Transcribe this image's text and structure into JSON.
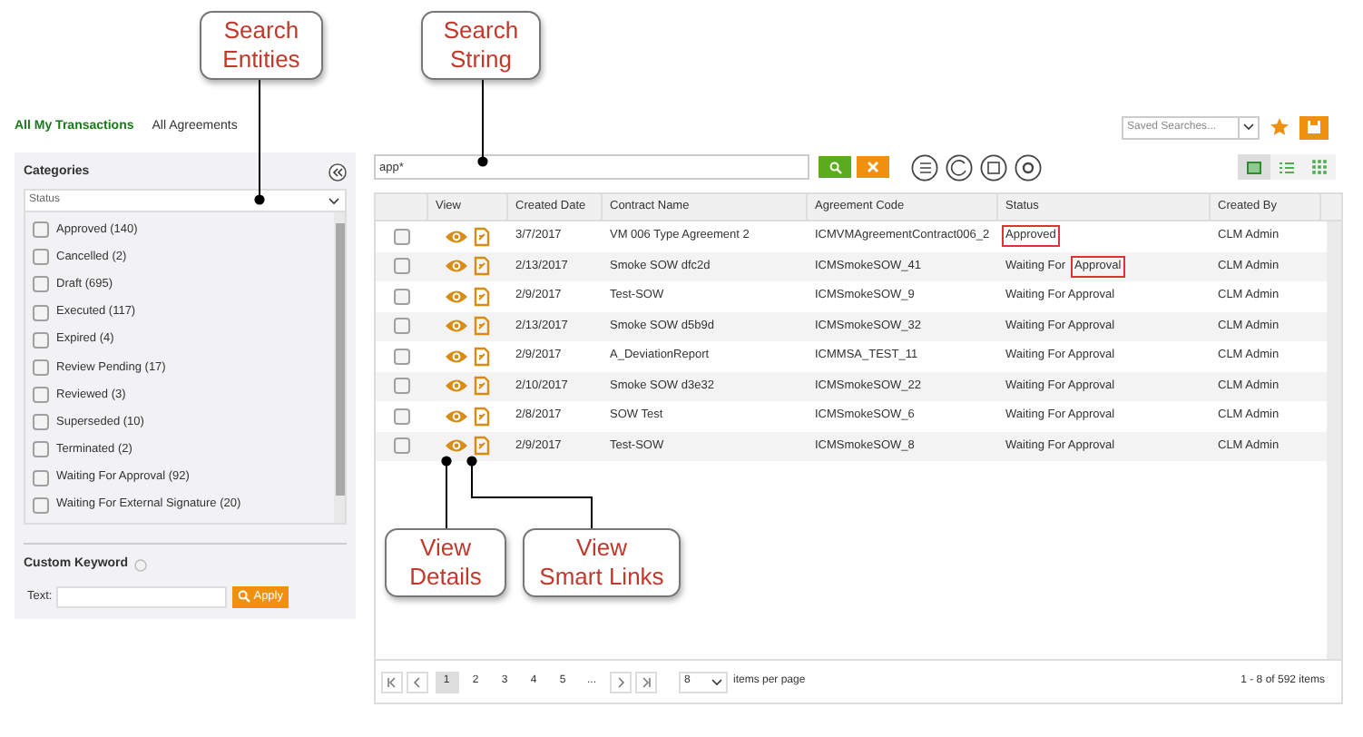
{
  "tabs": [
    {
      "label": "All My Transactions",
      "selected": true
    },
    {
      "label": "All Agreements",
      "selected": false
    }
  ],
  "sidebar": {
    "title": "Categories",
    "category_select": "Status",
    "items": [
      {
        "label": "Approved (140)",
        "checked": false
      },
      {
        "label": "Cancelled (2)",
        "checked": false
      },
      {
        "label": "Draft (695)",
        "checked": false
      },
      {
        "label": "Executed (117)",
        "checked": false
      },
      {
        "label": "Expired (4)",
        "checked": false
      },
      {
        "label": "Review Pending (17)",
        "checked": false
      },
      {
        "label": "Reviewed (3)",
        "checked": false
      },
      {
        "label": "Superseded (10)",
        "checked": false
      },
      {
        "label": "Terminated (2)",
        "checked": false
      },
      {
        "label": "Waiting For Approval (92)",
        "checked": false
      },
      {
        "label": "Waiting For External Signature (20)",
        "checked": false
      }
    ],
    "custom_keyword": {
      "title": "Custom Keyword",
      "text_label": "Text:",
      "apply": "Apply"
    }
  },
  "toolbar": {
    "saved_searches": {
      "placeholder": "Saved Searches..."
    },
    "search": {
      "value": "app*"
    }
  },
  "table": {
    "columns": [
      "View",
      "Created Date",
      "Contract Name",
      "Agreement Code",
      "Status",
      "Created By"
    ],
    "rows": [
      {
        "checked": false,
        "created_date": "3/7/2017",
        "contract_name": "VM 006 Type Agreement 2",
        "agreement_code": "ICMVMAgreementContract006_2",
        "status": [
          {
            "text": "Approved",
            "marked": true
          }
        ],
        "created_by": "CLM Admin"
      },
      {
        "checked": false,
        "created_date": "2/13/2017",
        "contract_name": "Smoke SOW dfc2d",
        "agreement_code": "ICMSmokeSOW_41",
        "status": [
          {
            "text": "Waiting For",
            "marked": false
          },
          {
            "text": "Approval",
            "marked": true
          }
        ],
        "created_by": "CLM Admin"
      },
      {
        "checked": false,
        "created_date": "2/9/2017",
        "contract_name": "Test-SOW",
        "agreement_code": "ICMSmokeSOW_9",
        "status": [
          {
            "text": "Waiting For Approval",
            "marked": false
          }
        ],
        "created_by": "CLM Admin"
      },
      {
        "checked": false,
        "created_date": "2/13/2017",
        "contract_name": "Smoke SOW d5b9d",
        "agreement_code": "ICMSmokeSOW_32",
        "status": [
          {
            "text": "Waiting For Approval",
            "marked": false
          }
        ],
        "created_by": "CLM Admin"
      },
      {
        "checked": false,
        "created_date": "2/9/2017",
        "contract_name": "A_DeviationReport",
        "agreement_code": "ICMMSA_TEST_11",
        "status": [
          {
            "text": "Waiting For Approval",
            "marked": false
          }
        ],
        "created_by": "CLM Admin"
      },
      {
        "checked": false,
        "created_date": "2/10/2017",
        "contract_name": "Smoke SOW d3e32",
        "agreement_code": "ICMSmokeSOW_22",
        "status": [
          {
            "text": "Waiting For Approval",
            "marked": false
          }
        ],
        "created_by": "CLM Admin"
      },
      {
        "checked": false,
        "created_date": "2/8/2017",
        "contract_name": "SOW Test",
        "agreement_code": "ICMSmokeSOW_6",
        "status": [
          {
            "text": "Waiting For Approval",
            "marked": false
          }
        ],
        "created_by": "CLM Admin"
      },
      {
        "checked": false,
        "created_date": "2/9/2017",
        "contract_name": "Test-SOW",
        "agreement_code": "ICMSmokeSOW_8",
        "status": [
          {
            "text": "Waiting For Approval",
            "marked": false
          }
        ],
        "created_by": "CLM Admin"
      }
    ]
  },
  "pager": {
    "pages": [
      {
        "label": "1",
        "selected": true
      },
      {
        "label": "2",
        "selected": false
      },
      {
        "label": "3",
        "selected": false
      },
      {
        "label": "4",
        "selected": false
      },
      {
        "label": "5",
        "selected": false
      },
      {
        "label": "...",
        "selected": false
      }
    ],
    "per_page": "8",
    "per_page_label": "items per page",
    "summary": "1 - 8 of 592 items"
  },
  "callouts": [
    {
      "lines": [
        "Search",
        "Entities"
      ]
    },
    {
      "lines": [
        "Search",
        "String"
      ]
    },
    {
      "lines": [
        "View",
        "Details"
      ]
    },
    {
      "lines": [
        "View",
        "Smart Links"
      ]
    }
  ]
}
